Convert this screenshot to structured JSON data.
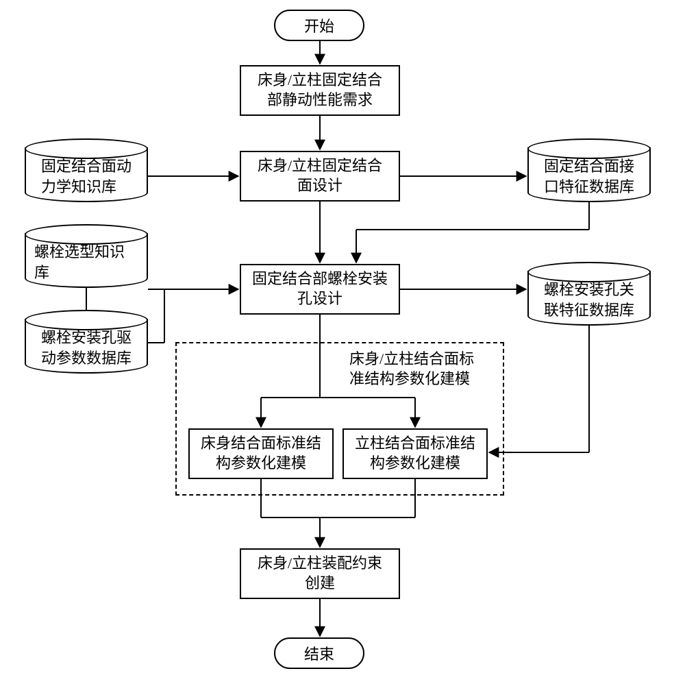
{
  "terminator": {
    "start": "开始",
    "end": "结束"
  },
  "process": {
    "req": "床身/立柱固定结合\n部静动性能需求",
    "surface_design": "床身/立柱固定结合\n面设计",
    "bolt_hole_design": "固定结合部螺栓安装\n孔设计",
    "bed_model": "床身结合面标准结\n构参数化建模",
    "col_model": "立柱结合面标准结\n构参数化建模",
    "assembly": "床身/立柱装配约束\n创建"
  },
  "dashed_group_label": "床身/立柱结合面标\n准结构参数化建模",
  "db": {
    "dynamics_kb": "固定结合面动\n力学知识库",
    "bolt_select_kb": "螺栓选型知识\n库",
    "bolt_hole_param_db": "螺栓安装孔驱\n动参数数据库",
    "interface_feat_db": "固定结合面接\n口特征数据库",
    "bolt_hole_rel_db": "螺栓安装孔关\n联特征数据库"
  }
}
